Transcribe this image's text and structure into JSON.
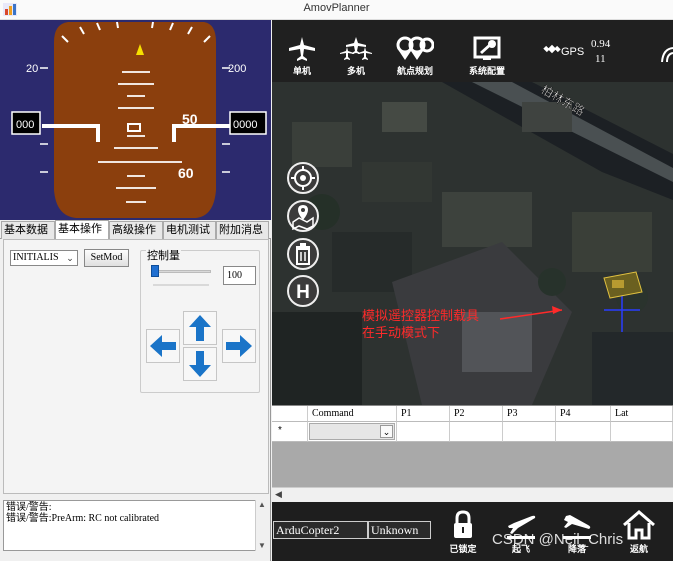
{
  "window": {
    "title": "AmovPlanner"
  },
  "hud": {
    "scale_left_value": "20",
    "scale_right_value": "200",
    "speed_readout": "000",
    "altitude_readout": "0000",
    "pitch_label_upper": "50",
    "pitch_label_lower": "60"
  },
  "tabs": [
    "基本数据",
    "基本操作",
    "高级操作",
    "电机测试",
    "附加消息"
  ],
  "active_tab_index": 1,
  "controls": {
    "mode_value": "INITIALIS",
    "setmode_label": "SetMod",
    "speed_group_label": "控制量",
    "speed_value": "100"
  },
  "messages": {
    "line1": "错误/警告:",
    "line2": "错误/警告:PreArm: RC not calibrated"
  },
  "toolbar": {
    "items": [
      {
        "label": "单机",
        "icon": "single-drone-icon"
      },
      {
        "label": "多机",
        "icon": "multi-drone-icon"
      },
      {
        "label": "航点规划",
        "icon": "waypoint-plan-icon"
      },
      {
        "label": "系统配置",
        "icon": "system-config-icon"
      }
    ],
    "gps_label": "GPS",
    "gps_hdop": "0.94",
    "gps_sats": "11"
  },
  "map": {
    "road_label": "柏林东路",
    "annotation_line1": "模拟遥控器控制载具",
    "annotation_line2": "在手动模式下",
    "map_buttons": [
      "target-icon",
      "map-marker-icon",
      "trash-icon",
      "home-h-icon"
    ]
  },
  "waypoint_table": {
    "columns": [
      "Command",
      "P1",
      "P2",
      "P3",
      "P4",
      "Lat"
    ],
    "new_row_marker": "*"
  },
  "status": {
    "vehicle": "ArduCopter2",
    "state": "Unknown"
  },
  "bottom_actions": [
    {
      "label": "已锁定",
      "icon": "lock-icon"
    },
    {
      "label": "起飞",
      "icon": "takeoff-icon"
    },
    {
      "label": "降落",
      "icon": "landing-icon"
    },
    {
      "label": "返航",
      "icon": "return-home-icon"
    }
  ],
  "watermark": "CSDN @Neil_Chris",
  "colors": {
    "hud_sky": "#2c2a6e",
    "hud_ground": "#8b3f0d",
    "arrow_blue": "#1a74c8",
    "annotation_red": "#ff2a2a",
    "toolbar_bg": "#202020"
  }
}
